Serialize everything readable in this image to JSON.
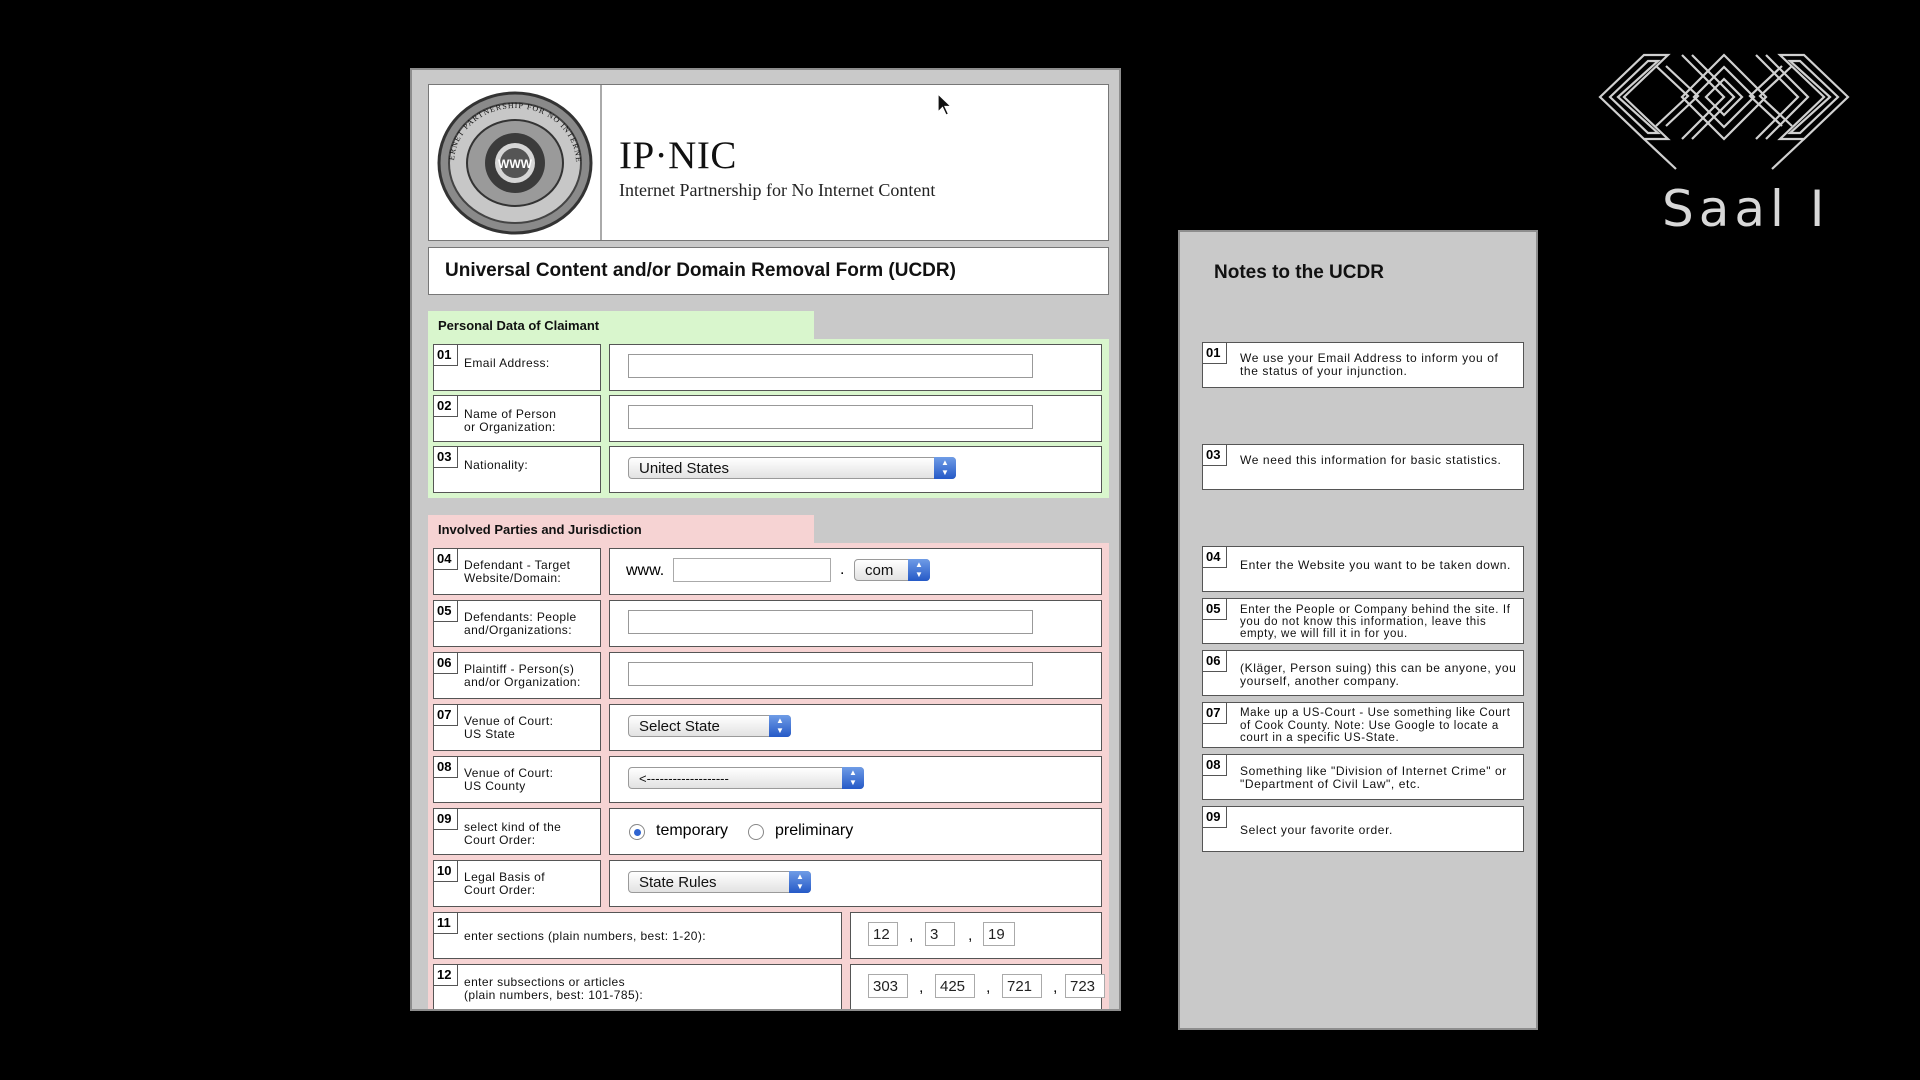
{
  "header": {
    "seal_text": "IP·NIC · INTERNET PARTNERSHIP FOR NO INTERNET CONTENT",
    "seal_center": "WWW",
    "brand_title": "IP·NIC",
    "brand_subtitle": "Internet Partnership for No Internet Content"
  },
  "form_title": "Universal Content and/or Domain Removal Form (UCDR)",
  "sections": {
    "personal": "Personal Data of Claimant",
    "involved": "Involved Parties and Jurisdiction"
  },
  "fields": {
    "email": {
      "num": "01",
      "label": "Email Address:",
      "value": ""
    },
    "name": {
      "num": "02",
      "label": "Name of Person\nor Organization:",
      "value": ""
    },
    "nationality": {
      "num": "03",
      "label": "Nationality:",
      "value": "United States"
    },
    "defendant_site": {
      "num": "04",
      "label": "Defendant - Target\nWebsite/Domain:",
      "prefix": "www.",
      "value": "",
      "dot": ".",
      "tld": "com"
    },
    "defendants_people": {
      "num": "05",
      "label": "Defendants: People\nand/Organizations:",
      "value": ""
    },
    "plaintiff": {
      "num": "06",
      "label": "Plaintiff - Person(s)\nand/or Organization:",
      "value": ""
    },
    "venue_state": {
      "num": "07",
      "label": "Venue of Court:\nUS State",
      "value": "Select State"
    },
    "venue_county": {
      "num": "08",
      "label": "Venue of Court:\nUS County",
      "value": "<-------------------"
    },
    "court_order": {
      "num": "09",
      "label": "select kind of the\nCourt Order:",
      "option1": "temporary",
      "option2": "preliminary",
      "selected": "temporary"
    },
    "legal_basis": {
      "num": "10",
      "label": "Legal Basis of\nCourt Order:",
      "value": "State Rules"
    },
    "sections_nums": {
      "num": "11",
      "label": "enter sections (plain numbers, best: 1-20):",
      "values": [
        "12",
        "3",
        "19"
      ]
    },
    "subsections_nums": {
      "num": "12",
      "label": "enter subsections or articles\n(plain numbers, best: 101-785):",
      "values": [
        "303",
        "425",
        "721",
        "723"
      ]
    }
  },
  "separator": ",",
  "notes": {
    "title": "Notes to the UCDR",
    "items": [
      {
        "num": "01",
        "text": "We use your Email Address to inform you of the status of your injunction."
      },
      {
        "num": "03",
        "text": "We need this information for basic statistics."
      },
      {
        "num": "04",
        "text": "Enter the Website you want to be taken down."
      },
      {
        "num": "05",
        "text": "Enter the People or Company behind the site. If you do not know this information, leave this empty, we will fill it in for you."
      },
      {
        "num": "06",
        "text": "(Kläger, Person suing) this can be anyone, you yourself, another company."
      },
      {
        "num": "07",
        "text": "Make up a US-Court - Use something like Court of Cook County. Note: Use Google to locate a court in a specific US-State."
      },
      {
        "num": "08",
        "text": "Something like \"Division of Internet Crime\" or \"Department of Civil Law\", etc."
      },
      {
        "num": "09",
        "text": "Select your favorite order."
      }
    ]
  },
  "logo": {
    "label": "Saal I"
  },
  "colors": {
    "background": "#000000",
    "panel": "#c9c9c9",
    "personal_section": "#d9f6cd",
    "involved_section": "#f6d3d3",
    "select_arrow": "#2f64d1"
  }
}
